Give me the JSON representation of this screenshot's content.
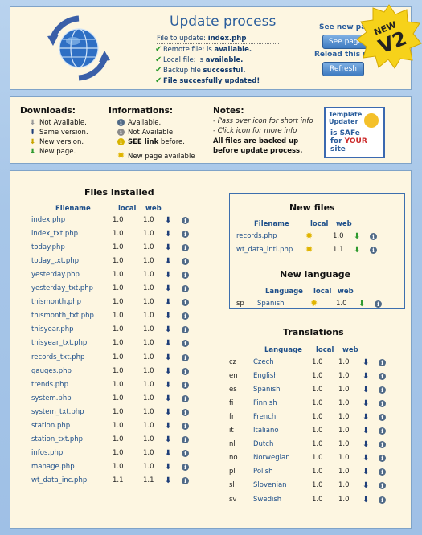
{
  "header": {
    "title": "Update process",
    "file_label": "File to update:",
    "file_name": "index.php",
    "status": [
      {
        "prefix": "Remote file: is ",
        "value": "available."
      },
      {
        "prefix": "Local file: is ",
        "value": "available."
      },
      {
        "prefix": "Backup file ",
        "value": "successful."
      },
      {
        "prefix": "",
        "value": "File succesfully updated!"
      }
    ],
    "see_new_label": "See new pa",
    "see_page_button": "See page",
    "reload_label": "Reload this pa",
    "refresh_button": "Refresh",
    "badge_new": "NEW",
    "badge_v2": "V2"
  },
  "legend": {
    "downloads_title": "Downloads:",
    "downloads": [
      "Not Available.",
      "Same version.",
      "New version.",
      "New page."
    ],
    "informations_title": "Informations:",
    "info_items": [
      "Available.",
      "Not Available."
    ],
    "see_link_bold": "SEE link",
    "see_link_rest": " before.",
    "new_page_available": "New page available",
    "notes_title": "Notes:",
    "notes": [
      "- Pass over icon for short info",
      "- Click icon for more info"
    ],
    "backup_note_1": "All files are backed up",
    "backup_note_2": "before update process.",
    "safe_line1": "Template",
    "safe_line2": "Updater",
    "safe_line3": "is SAFe",
    "safe_line4_a": "for ",
    "safe_line4_b": "YOUR",
    "safe_line4_c": " site"
  },
  "files_installed": {
    "title": "Files installed",
    "col_filename": "Filename",
    "col_local": "local",
    "col_web": "web",
    "rows": [
      {
        "name": "index.php",
        "local": "1.0",
        "web": "1.0"
      },
      {
        "name": "index_txt.php",
        "local": "1.0",
        "web": "1.0"
      },
      {
        "name": "today.php",
        "local": "1.0",
        "web": "1.0"
      },
      {
        "name": "today_txt.php",
        "local": "1.0",
        "web": "1.0"
      },
      {
        "name": "yesterday.php",
        "local": "1.0",
        "web": "1.0"
      },
      {
        "name": "yesterday_txt.php",
        "local": "1.0",
        "web": "1.0"
      },
      {
        "name": "thismonth.php",
        "local": "1.0",
        "web": "1.0"
      },
      {
        "name": "thismonth_txt.php",
        "local": "1.0",
        "web": "1.0"
      },
      {
        "name": "thisyear.php",
        "local": "1.0",
        "web": "1.0"
      },
      {
        "name": "thisyear_txt.php",
        "local": "1.0",
        "web": "1.0"
      },
      {
        "name": "records_txt.php",
        "local": "1.0",
        "web": "1.0"
      },
      {
        "name": "gauges.php",
        "local": "1.0",
        "web": "1.0"
      },
      {
        "name": "trends.php",
        "local": "1.0",
        "web": "1.0"
      },
      {
        "name": "system.php",
        "local": "1.0",
        "web": "1.0"
      },
      {
        "name": "system_txt.php",
        "local": "1.0",
        "web": "1.0"
      },
      {
        "name": "station.php",
        "local": "1.0",
        "web": "1.0"
      },
      {
        "name": "station_txt.php",
        "local": "1.0",
        "web": "1.0"
      },
      {
        "name": "infos.php",
        "local": "1.0",
        "web": "1.0"
      },
      {
        "name": "manage.php",
        "local": "1.0",
        "web": "1.0"
      },
      {
        "name": "wt_data_inc.php",
        "local": "1.1",
        "web": "1.1"
      }
    ]
  },
  "new_files": {
    "title": "New files",
    "col_filename": "Filename",
    "col_local": "local",
    "col_web": "web",
    "rows": [
      {
        "name": "records.php",
        "web": "1.0"
      },
      {
        "name": "wt_data_intl.php",
        "web": "1.1"
      }
    ]
  },
  "new_language": {
    "title": "New language",
    "col_language": "Language",
    "col_local": "local",
    "col_web": "web",
    "rows": [
      {
        "code": "sp",
        "name": "Spanish",
        "web": "1.0"
      }
    ]
  },
  "translations": {
    "title": "Translations",
    "col_language": "Language",
    "col_local": "local",
    "col_web": "web",
    "rows": [
      {
        "code": "cz",
        "name": "Czech",
        "local": "1.0",
        "web": "1.0"
      },
      {
        "code": "en",
        "name": "English",
        "local": "1.0",
        "web": "1.0"
      },
      {
        "code": "es",
        "name": "Spanish",
        "local": "1.0",
        "web": "1.0"
      },
      {
        "code": "fi",
        "name": "Finnish",
        "local": "1.0",
        "web": "1.0"
      },
      {
        "code": "fr",
        "name": "French",
        "local": "1.0",
        "web": "1.0"
      },
      {
        "code": "it",
        "name": "Italiano",
        "local": "1.0",
        "web": "1.0"
      },
      {
        "code": "nl",
        "name": "Dutch",
        "local": "1.0",
        "web": "1.0"
      },
      {
        "code": "no",
        "name": "Norwegian",
        "local": "1.0",
        "web": "1.0"
      },
      {
        "code": "pl",
        "name": "Polish",
        "local": "1.0",
        "web": "1.0"
      },
      {
        "code": "sl",
        "name": "Slovenian",
        "local": "1.0",
        "web": "1.0"
      },
      {
        "code": "sv",
        "name": "Swedish",
        "local": "1.0",
        "web": "1.0"
      }
    ]
  }
}
